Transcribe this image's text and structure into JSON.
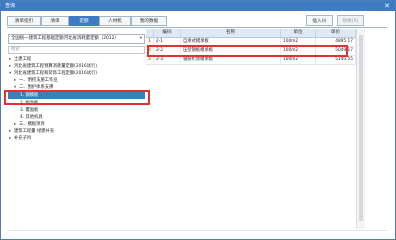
{
  "window": {
    "title": "查询",
    "close_glyph": "✕"
  },
  "tabs": [
    {
      "label": "清单指引",
      "active": false
    },
    {
      "label": "清单",
      "active": false
    },
    {
      "label": "定额",
      "active": true
    },
    {
      "label": "人材机",
      "active": false
    },
    {
      "label": "我的数据",
      "active": false
    }
  ],
  "toolbar": {
    "insert_label": "插入(I)",
    "replace_label": "替换(R)"
  },
  "quota_library": {
    "selected": "全国统一建筑工程基础定额河北省消耗量定额（2012）",
    "arrow": "▾"
  },
  "search": {
    "placeholder": "搜索"
  },
  "tree": [
    {
      "label": "土建工程",
      "toggle": "▸"
    },
    {
      "label": "河北省建筑工程预算消耗量定额(2016试行)",
      "toggle": "▸"
    },
    {
      "label": "河北省建筑工程和装饰工程定额(2016试行)",
      "toggle": "▾"
    },
    {
      "label": "一、明挖法施工作业",
      "toggle": "▸"
    },
    {
      "label": "二、围护体系支撑",
      "toggle": "▾"
    },
    {
      "label": "1. 钢模板",
      "toggle": ""
    },
    {
      "label": "2. 组合板",
      "toggle": ""
    },
    {
      "label": "3. 覆面板",
      "toggle": ""
    },
    {
      "label": "4. 其他机具",
      "toggle": ""
    },
    {
      "label": "三、模板项目",
      "toggle": "▸"
    },
    {
      "label": "建筑工程量 绿建补充",
      "toggle": "▸"
    },
    {
      "label": "补充子目",
      "toggle": "▸"
    }
  ],
  "table": {
    "headers": [
      "",
      "编码",
      "名称",
      "单位",
      "单价"
    ],
    "rows": [
      {
        "idx": "1",
        "code": "2-1",
        "name": "自承式模承板",
        "unit": "100m2",
        "price": "4895.17"
      },
      {
        "idx": "2",
        "code": "2-2",
        "name": "压型钢板模承板",
        "unit": "100m2",
        "price": "5049.17"
      },
      {
        "idx": "3",
        "code": "2-3",
        "name": "钢筋桁架模承板",
        "unit": "100m2",
        "price": "5140.55"
      }
    ]
  }
}
